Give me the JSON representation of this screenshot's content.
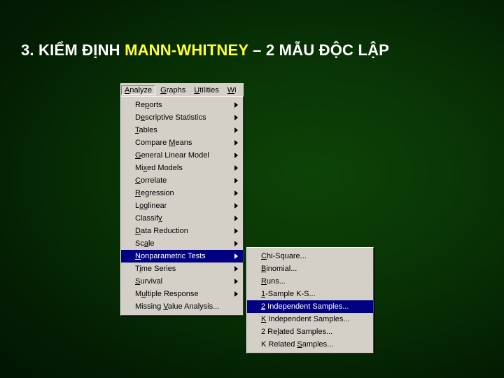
{
  "slide": {
    "title": {
      "prefix": "3. KIỂM ĐỊNH ",
      "highlight": "MANN-WHITNEY",
      "suffix": " – 2 MẪU ĐỘC LẬP",
      "full_text": "3. KIỂM ĐỊNH MANN-WHITNEY – 2 MẪU ĐỘC LẬP"
    },
    "colors": {
      "background_dark": "#021a02",
      "background_light": "#0d4307",
      "title_text": "#ffffff",
      "title_highlight": "#ffff33",
      "menu_face": "#d4d0c8",
      "menu_text": "#000000",
      "menu_highlight": "#000080",
      "menu_highlight_text": "#ffffff"
    }
  },
  "menubar": {
    "items": [
      {
        "label": "Analyze",
        "mnemonic": "A",
        "open": true
      },
      {
        "label": "Graphs",
        "mnemonic": "G",
        "open": false
      },
      {
        "label": "Utilities",
        "mnemonic": "U",
        "open": false
      },
      {
        "label": "Wi",
        "mnemonic": "W",
        "open": false
      }
    ]
  },
  "analyze_menu": {
    "items": [
      {
        "label": "Reports",
        "mnemonic": "p",
        "submenu": true,
        "selected": false
      },
      {
        "label": "Descriptive Statistics",
        "mnemonic": "e",
        "submenu": true,
        "selected": false
      },
      {
        "label": "Tables",
        "mnemonic": "T",
        "submenu": true,
        "selected": false
      },
      {
        "label": "Compare Means",
        "mnemonic": "M",
        "submenu": true,
        "selected": false
      },
      {
        "label": "General Linear Model",
        "mnemonic": "G",
        "submenu": true,
        "selected": false
      },
      {
        "label": "Mixed Models",
        "mnemonic": "x",
        "submenu": true,
        "selected": false
      },
      {
        "label": "Correlate",
        "mnemonic": "C",
        "submenu": true,
        "selected": false
      },
      {
        "label": "Regression",
        "mnemonic": "R",
        "submenu": true,
        "selected": false
      },
      {
        "label": "Loglinear",
        "mnemonic": "o",
        "submenu": true,
        "selected": false
      },
      {
        "label": "Classify",
        "mnemonic": "y",
        "submenu": true,
        "selected": false
      },
      {
        "label": "Data Reduction",
        "mnemonic": "D",
        "submenu": true,
        "selected": false
      },
      {
        "label": "Scale",
        "mnemonic": "a",
        "submenu": true,
        "selected": false
      },
      {
        "label": "Nonparametric Tests",
        "mnemonic": "N",
        "submenu": true,
        "selected": true
      },
      {
        "label": "Time Series",
        "mnemonic": "i",
        "submenu": true,
        "selected": false
      },
      {
        "label": "Survival",
        "mnemonic": "S",
        "submenu": true,
        "selected": false
      },
      {
        "label": "Multiple Response",
        "mnemonic": "u",
        "submenu": true,
        "selected": false
      },
      {
        "label": "Missing Value Analysis...",
        "mnemonic": "V",
        "submenu": false,
        "selected": false
      }
    ]
  },
  "submenu": {
    "items": [
      {
        "label": "Chi-Square...",
        "mnemonic": "C",
        "selected": false
      },
      {
        "label": "Binomial...",
        "mnemonic": "B",
        "selected": false
      },
      {
        "label": "Runs...",
        "mnemonic": "R",
        "selected": false
      },
      {
        "label": "1-Sample K-S...",
        "mnemonic": "1",
        "selected": false
      },
      {
        "label": "2 Independent Samples...",
        "mnemonic": "2",
        "selected": true
      },
      {
        "label": "K Independent Samples...",
        "mnemonic": "K",
        "selected": false
      },
      {
        "label": "2 Related Samples...",
        "mnemonic": "l",
        "selected": false
      },
      {
        "label": "K Related Samples...",
        "mnemonic": "S",
        "selected": false
      }
    ]
  }
}
